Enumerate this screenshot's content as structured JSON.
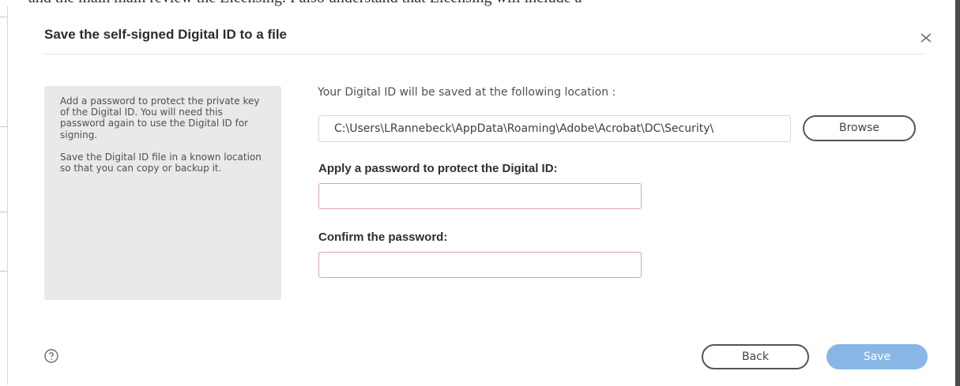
{
  "background_document": {
    "partial_text": "and the main main review the Licensing. I also understand that Licensing will include a"
  },
  "dialog": {
    "title": "Save the self-signed Digital ID to a file",
    "close_icon": "close-icon",
    "info_panel": {
      "paragraph_1": "Add a password to protect the private key of the Digital ID. You will need this password again to use the Digital ID for signing.",
      "paragraph_2": "Save the Digital ID file in a known location so that you can copy or backup it."
    },
    "location_label": "Your Digital ID will be saved at the following location :",
    "location_path": "C:\\Users\\LRannebeck\\AppData\\Roaming\\Adobe\\Acrobat\\DC\\Security\\",
    "browse_label": "Browse",
    "password_label": "Apply a password to protect the Digital ID:",
    "password_value": "",
    "confirm_label": "Confirm the password:",
    "confirm_value": "",
    "help_icon": "help-icon",
    "back_label": "Back",
    "save_label": "Save",
    "colors": {
      "save_button": "#88b7e6",
      "invalid_field_border": "#e0a0a6",
      "info_panel_bg": "#e9e9e9"
    }
  }
}
